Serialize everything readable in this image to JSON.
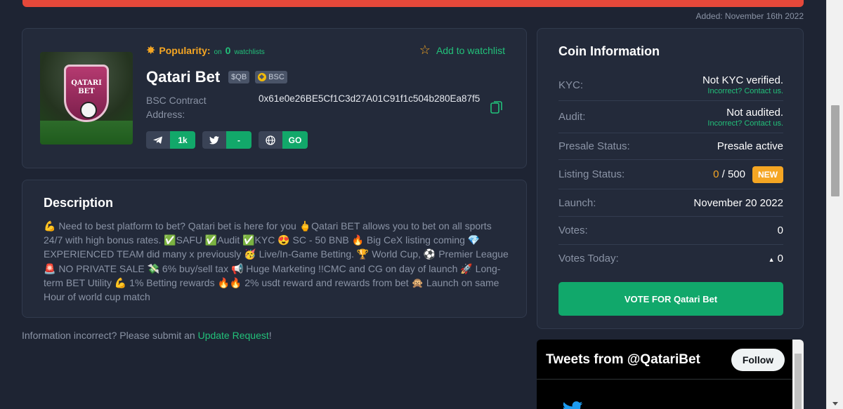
{
  "added": "Added: November 16th 2022",
  "coin": {
    "logo_text": "QATARI\nBET",
    "popularity_label": "Popularity:",
    "popularity_on": "on",
    "popularity_count": "0",
    "popularity_unit": "watchlists",
    "watchlist_label": "Add to watchlist",
    "name": "Qatari Bet",
    "symbol": "$QB",
    "chain": "BSC",
    "contract_label": "BSC Contract Address:",
    "contract_address": "0x61e0e26BE5Cf1C3d27A01C91f1c504b280Ea87f5",
    "socials": [
      {
        "icon": "telegram-icon",
        "value": "1k"
      },
      {
        "icon": "twitter-icon",
        "value": "-"
      },
      {
        "icon": "globe-icon",
        "value": "GO"
      }
    ]
  },
  "description": {
    "title": "Description",
    "text": "💪 Need to best platform to bet? Qatari bet is here for you 🖕Qatari BET allows you to bet on all sports 24/7 with high bonus rates. ✅SAFU ✅Audit ✅KYC 😍 SC - 50 BNB 🔥 Big CeX listing coming 💎 EXPERIENCED TEAM did many x previously 🥳 Live/In-Game Betting. 🏆 World Cup, ⚽ Premier League🚨 NO PRIVATE SALE 💸 6% buy/sell tax 📢 Huge Marketing !!CMC and CG on day of launch 🚀 Long-term BET Utility 💪 1% Betting rewards 🔥🔥 2% usdt reward and rewards from bet 🙊 Launch on same Hour of world cup match"
  },
  "update_note": {
    "text": "Information incorrect? Please submit an",
    "link": "Update Request",
    "suffix": "!"
  },
  "info": {
    "title": "Coin Information",
    "kyc_label": "KYC:",
    "kyc_value": "Not KYC verified.",
    "kyc_sub": "Incorrect? Contact us.",
    "audit_label": "Audit:",
    "audit_value": "Not audited.",
    "audit_sub": "Incorrect? Contact us.",
    "presale_label": "Presale Status:",
    "presale_value": "Presale active",
    "listing_label": "Listing Status:",
    "listing_current": "0",
    "listing_sep": " / ",
    "listing_total": "500",
    "listing_badge": "NEW",
    "launch_label": "Launch:",
    "launch_value": "November 20 2022",
    "votes_label": "Votes:",
    "votes_value": "0",
    "votes_today_label": "Votes Today:",
    "votes_today_value": "0",
    "vote_button": "VOTE FOR Qatari Bet"
  },
  "tweets": {
    "title": "Tweets from @QatariBet",
    "follow": "Follow"
  },
  "colors": {
    "background": "#1e2433",
    "card": "#232a3a",
    "accent_green": "#22c17a",
    "accent_orange": "#f5a623",
    "alert_red": "#e5483a"
  }
}
